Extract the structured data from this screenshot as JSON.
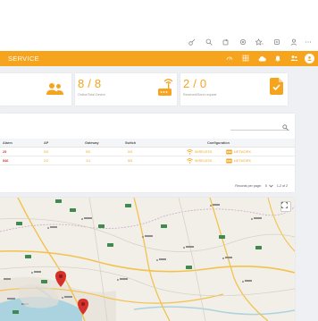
{
  "browser": {
    "toolbar_icons": [
      "key-icon",
      "zoom-icon",
      "puzzle-icon",
      "settings-icon",
      "star-icon",
      "collections-icon",
      "profile-icon",
      "more-icon"
    ]
  },
  "header": {
    "title": "SERVICE",
    "icons": [
      "dashboard-icon",
      "grid-icon",
      "cloud-icon",
      "bell-icon",
      "users-icon",
      "account-icon"
    ]
  },
  "cards": [
    {
      "value": "",
      "label": "",
      "icon": "users-icon"
    },
    {
      "value": "8 / 8",
      "label": "Online/Total Device",
      "icon": "router-icon"
    },
    {
      "value": "2 / 0",
      "label": "Received/Send request",
      "icon": "document-check-icon"
    }
  ],
  "table": {
    "columns": [
      "Alarm",
      "AP",
      "Gateway",
      "Switch",
      "Configuration"
    ],
    "rows": [
      {
        "alarm": "25",
        "ap": "0/0",
        "gateway": "0/0",
        "switch": "0/0",
        "wireless": "WIRELESS",
        "network": "NETWORK"
      },
      {
        "alarm": "546",
        "ap": "2/2",
        "gateway": "1/1",
        "switch": "5/5",
        "wireless": "WIRELESS",
        "network": "NETWORK"
      }
    ],
    "pager": {
      "label": "Records per page:",
      "per_page": "5",
      "range": "1-2 of 2"
    }
  },
  "colors": {
    "accent": "#f6a31d",
    "alarm": "#e4322b",
    "marker": "#d6302a"
  }
}
